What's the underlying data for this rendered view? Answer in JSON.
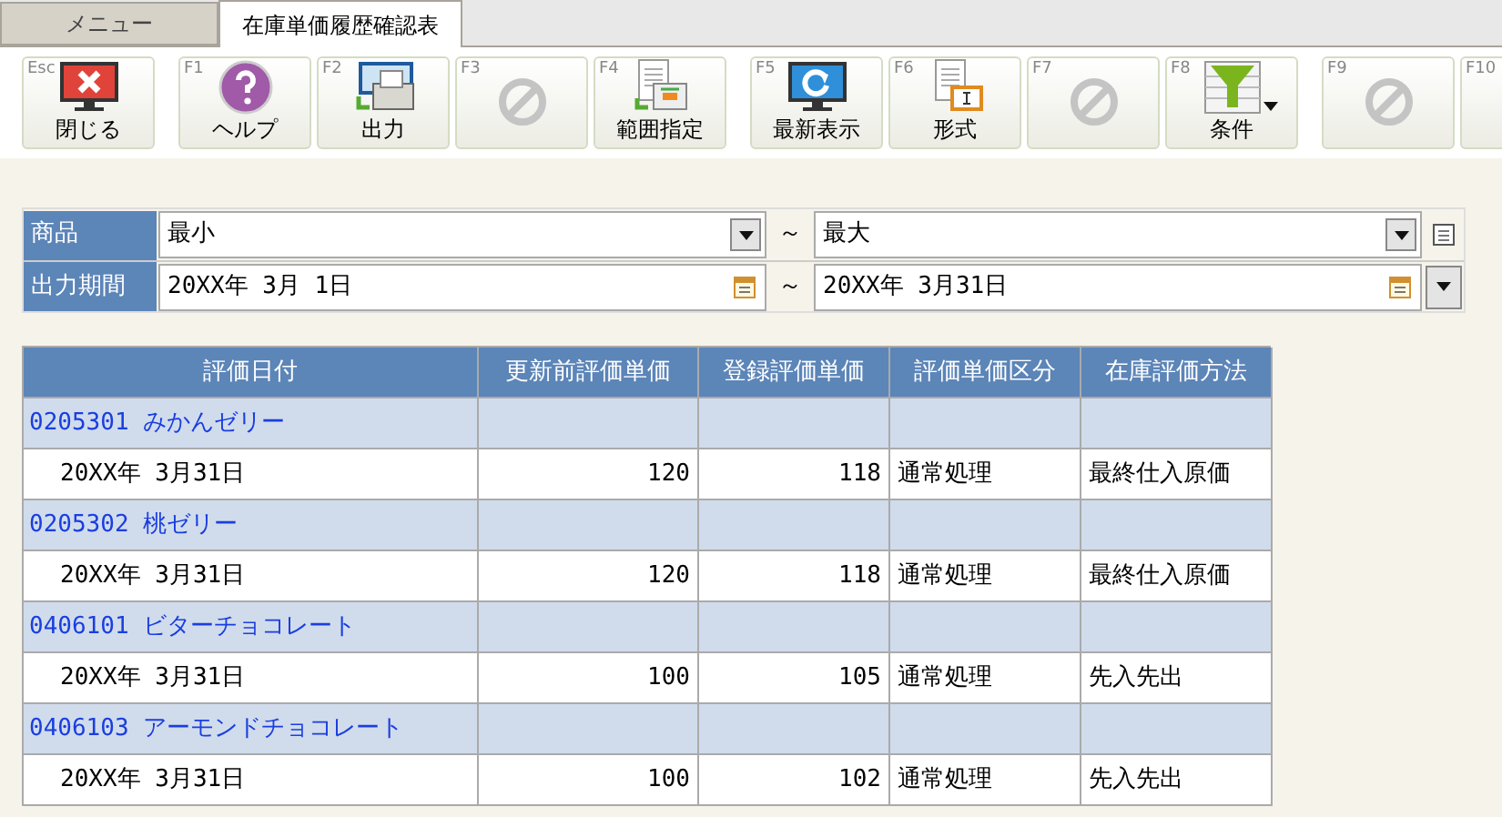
{
  "tabs": [
    {
      "label": "メニュー",
      "selected": false
    },
    {
      "label": "在庫単価履歴確認表",
      "selected": true
    }
  ],
  "toolbar_groups": [
    [
      {
        "key": "Esc",
        "label": "閉じる",
        "kind": "close"
      }
    ],
    [
      {
        "key": "F1",
        "label": "ヘルプ",
        "kind": "help"
      },
      {
        "key": "F2",
        "label": "出力",
        "kind": "print"
      },
      {
        "key": "F3",
        "kind": "disabled"
      },
      {
        "key": "F4",
        "label": "範囲指定",
        "kind": "range"
      }
    ],
    [
      {
        "key": "F5",
        "label": "最新表示",
        "kind": "refresh"
      },
      {
        "key": "F6",
        "label": "形式",
        "kind": "format"
      },
      {
        "key": "F7",
        "kind": "disabled"
      },
      {
        "key": "F8",
        "label": "条件",
        "kind": "filter",
        "dropdown": true
      }
    ],
    [
      {
        "key": "F9",
        "kind": "disabled"
      },
      {
        "key": "F10",
        "kind": "blank"
      }
    ]
  ],
  "filters": {
    "product": {
      "label": "商品",
      "from": "最小",
      "sep": "～",
      "to": "最大"
    },
    "period": {
      "label": "出力期間",
      "from": "20XX年 3月 1日",
      "sep": "～",
      "to": "20XX年 3月31日"
    }
  },
  "table": {
    "columns": [
      "評価日付",
      "更新前評価単価",
      "登録評価単価",
      "評価単価区分",
      "在庫評価方法"
    ],
    "groups": [
      {
        "product": "0205301 みかんゼリー",
        "rows": [
          [
            "20XX年 3月31日",
            "120",
            "118",
            "通常処理",
            "最終仕入原価"
          ]
        ]
      },
      {
        "product": "0205302 桃ゼリー",
        "rows": [
          [
            "20XX年 3月31日",
            "120",
            "118",
            "通常処理",
            "最終仕入原価"
          ]
        ]
      },
      {
        "product": "0406101 ビターチョコレート",
        "rows": [
          [
            "20XX年 3月31日",
            "100",
            "105",
            "通常処理",
            "先入先出"
          ]
        ]
      },
      {
        "product": "0406103 アーモンドチョコレート",
        "rows": [
          [
            "20XX年 3月31日",
            "100",
            "102",
            "通常処理",
            "先入先出"
          ]
        ]
      }
    ]
  }
}
